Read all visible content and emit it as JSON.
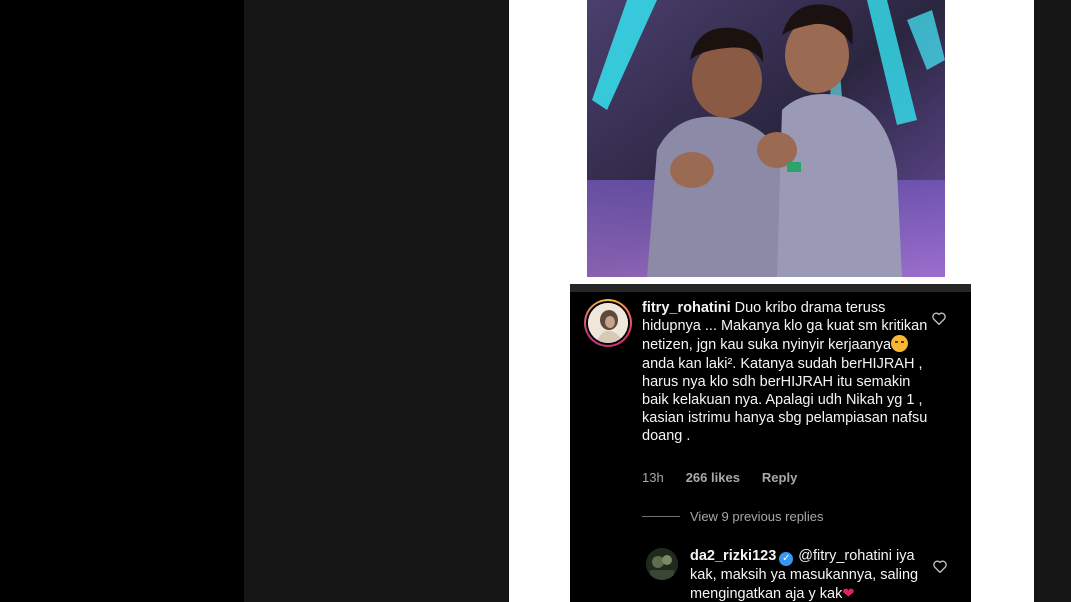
{
  "post": {
    "photo_alt": "Two men in grey suits hugging on stage"
  },
  "comment": {
    "username": "fitry_rohatini",
    "text_part1": "Duo kribo drama teruss hidupnya ... Makanya klo ga kuat sm kritikan netizen, jgn kau  suka nyinyir kerjaanya",
    "emoji": "😖",
    "text_part2": " anda kan laki². Katanya sudah berHIJRAH , harus nya klo sdh berHIJRAH itu semakin baik kelakuan nya. Apalagi udh Nikah yg 1 , kasian istrimu hanya sbg pelampiasan nafsu doang .",
    "time": "13h",
    "likes": "266 likes",
    "reply_label": "Reply"
  },
  "replies": {
    "view_previous": "View 9 previous replies"
  },
  "reply": {
    "username": "da2_rizki123",
    "verified_mark": "✓",
    "mention": "@fitry_rohatini",
    "text": " iya kak, maksih ya masukannya, saling mengingatkan aja y kak",
    "heart": "❤"
  },
  "icons": {
    "like": "heart-outline-icon",
    "verified": "verified-badge-icon"
  },
  "colors": {
    "comment_bg": "#000000",
    "meta_text": "#a8a8a8",
    "verified": "#3897f0"
  }
}
